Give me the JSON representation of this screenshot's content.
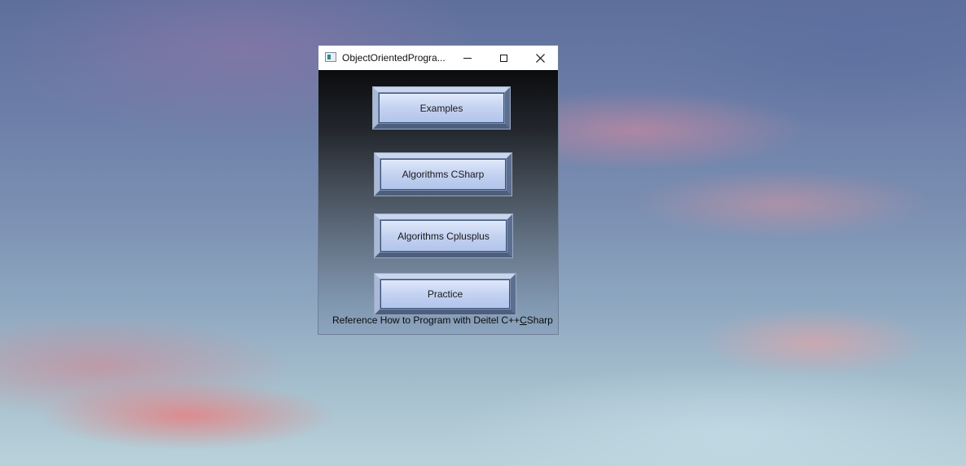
{
  "window": {
    "title": "ObjectOrientedProgra..."
  },
  "buttons": {
    "examples": "Examples",
    "algorithms_csharp": "Algorithms CSharp",
    "algorithms_cplusplus": "Algorithms Cplusplus",
    "practice": "Practice"
  },
  "footer": {
    "reference_prefix": "Reference How to Program with Deitel C++",
    "reference_mnemonic": "C",
    "reference_suffix": "Sharp"
  },
  "icons": {
    "app": "app-window-icon",
    "minimize": "minimize-icon",
    "maximize": "maximize-icon",
    "close": "close-icon"
  }
}
